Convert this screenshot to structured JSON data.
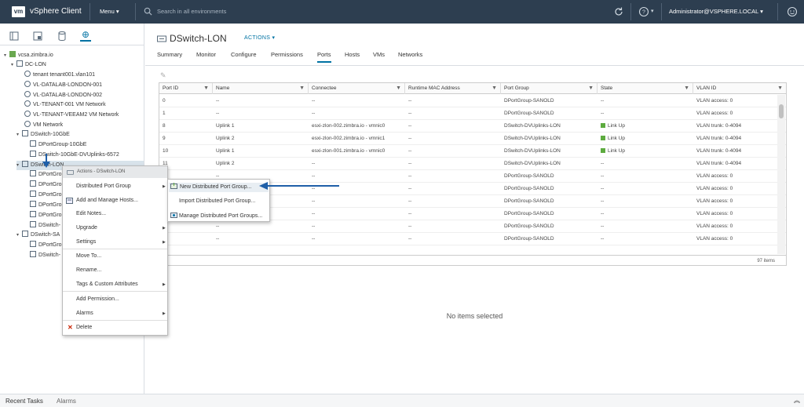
{
  "topbar": {
    "logo": "vm",
    "app_name": "vSphere Client",
    "menu_label": "Menu",
    "search_placeholder": "Search in all environments",
    "user": "Administrator@VSPHERE.LOCAL"
  },
  "tree": {
    "items": [
      {
        "label": "vcsa.zimbra.io",
        "icon": "vcenter-icon"
      },
      {
        "label": "DC-LON",
        "icon": "datacenter-icon"
      },
      {
        "label": "tenant tenant001.vlan101",
        "icon": "network-icon"
      },
      {
        "label": "VL-DATALAB-LONDON-001",
        "icon": "network-icon"
      },
      {
        "label": "VL-DATALAB-LONDON-002",
        "icon": "network-icon"
      },
      {
        "label": "VL-TENANT-001 VM Network",
        "icon": "network-icon"
      },
      {
        "label": "VL-TENANT-VEEAM2 VM Network",
        "icon": "network-icon"
      },
      {
        "label": "VM Network",
        "icon": "network-icon"
      },
      {
        "label": "DSwitch-10GbE",
        "icon": "dswitch-icon"
      },
      {
        "label": "DPortGroup-10GbE",
        "icon": "portgroup-icon"
      },
      {
        "label": "DSwitch-10GbE-DVUplinks-6572",
        "icon": "portgroup-icon"
      },
      {
        "label": "DSwitch-LON",
        "icon": "dswitch-icon"
      },
      {
        "label": "DPortGro",
        "icon": "portgroup-icon"
      },
      {
        "label": "DPortGro",
        "icon": "portgroup-icon"
      },
      {
        "label": "DPortGro",
        "icon": "portgroup-icon"
      },
      {
        "label": "DPortGro",
        "icon": "portgroup-icon"
      },
      {
        "label": "DPortGro",
        "icon": "portgroup-icon"
      },
      {
        "label": "DSwitch-",
        "icon": "portgroup-icon"
      },
      {
        "label": "DSwitch-SA",
        "icon": "dswitch-icon"
      },
      {
        "label": "DPortGro",
        "icon": "portgroup-icon"
      },
      {
        "label": "DSwitch-",
        "icon": "portgroup-icon"
      }
    ]
  },
  "main": {
    "title": "DSwitch-LON",
    "actions_label": "ACTIONS",
    "tabs": [
      "Summary",
      "Monitor",
      "Configure",
      "Permissions",
      "Ports",
      "Hosts",
      "VMs",
      "Networks"
    ],
    "active_tab": "Ports",
    "grid": {
      "columns": [
        "Port ID",
        "Name",
        "Connectee",
        "Runtime MAC Address",
        "Port Group",
        "State",
        "VLAN ID"
      ],
      "rows": [
        [
          "0",
          "--",
          "--",
          "--",
          "DPortGroup-SANOLD",
          "--",
          "VLAN access: 0"
        ],
        [
          "1",
          "--",
          "--",
          "--",
          "DPortGroup-SANOLD",
          "--",
          "VLAN access: 0"
        ],
        [
          "8",
          "Uplink 1",
          "esxi-zlon-002.zimbra.io - vmnic0",
          "--",
          "DSwitch-DVUplinks-LON",
          "Link Up",
          "VLAN trunk: 0-4094"
        ],
        [
          "9",
          "Uplink 2",
          "esxi-zlon-002.zimbra.io - vmnic1",
          "--",
          "DSwitch-DVUplinks-LON",
          "Link Up",
          "VLAN trunk: 0-4094"
        ],
        [
          "10",
          "Uplink 1",
          "esxi-zlon-001.zimbra.io - vmnic0",
          "--",
          "DSwitch-DVUplinks-LON",
          "Link Up",
          "VLAN trunk: 0-4094"
        ],
        [
          "11",
          "Uplink 2",
          "--",
          "--",
          "DSwitch-DVUplinks-LON",
          "--",
          "VLAN trunk: 0-4094"
        ],
        [
          "",
          "--",
          "--",
          "--",
          "DPortGroup-SANOLD",
          "--",
          "VLAN access: 0"
        ],
        [
          "",
          "--",
          "--",
          "--",
          "DPortGroup-SANOLD",
          "--",
          "VLAN access: 0"
        ],
        [
          "",
          "--",
          "--",
          "--",
          "DPortGroup-SANOLD",
          "--",
          "VLAN access: 0"
        ],
        [
          "",
          "--",
          "--",
          "--",
          "DPortGroup-SANOLD",
          "--",
          "VLAN access: 0"
        ],
        [
          "",
          "--",
          "--",
          "--",
          "DPortGroup-SANOLD",
          "--",
          "VLAN access: 0"
        ],
        [
          "",
          "--",
          "--",
          "--",
          "DPortGroup-SANOLD",
          "--",
          "VLAN access: 0"
        ]
      ],
      "footer": "97 items"
    },
    "no_items": "No items selected"
  },
  "context_menu": {
    "header": "Actions - DSwitch-LON",
    "items": [
      {
        "label": "Distributed Port Group",
        "submenu": true
      },
      {
        "label": "Add and Manage Hosts...",
        "icon": "add-hosts-icon"
      },
      {
        "label": "Edit Notes..."
      },
      {
        "label": "Upgrade",
        "submenu": true
      },
      {
        "label": "Settings",
        "submenu": true
      },
      {
        "label": "Move To..."
      },
      {
        "label": "Rename..."
      },
      {
        "label": "Tags & Custom Attributes",
        "submenu": true
      },
      {
        "label": "Add Permission..."
      },
      {
        "label": "Alarms",
        "submenu": true
      },
      {
        "label": "Delete",
        "icon": "delete-icon"
      }
    ]
  },
  "submenu": {
    "items": [
      {
        "label": "New Distributed Port Group...",
        "icon": "new-portgroup-icon"
      },
      {
        "label": "Import Distributed Port Group..."
      },
      {
        "label": "Manage Distributed Port Groups...",
        "icon": "manage-portgroups-icon"
      }
    ]
  },
  "bottombar": {
    "recent_tasks": "Recent Tasks",
    "alarms": "Alarms"
  },
  "colors": {
    "topbar": "#2d3e50",
    "accent": "#0072a3",
    "annotation_arrow": "#1f5fa8",
    "link_up": "#5dab3f"
  }
}
